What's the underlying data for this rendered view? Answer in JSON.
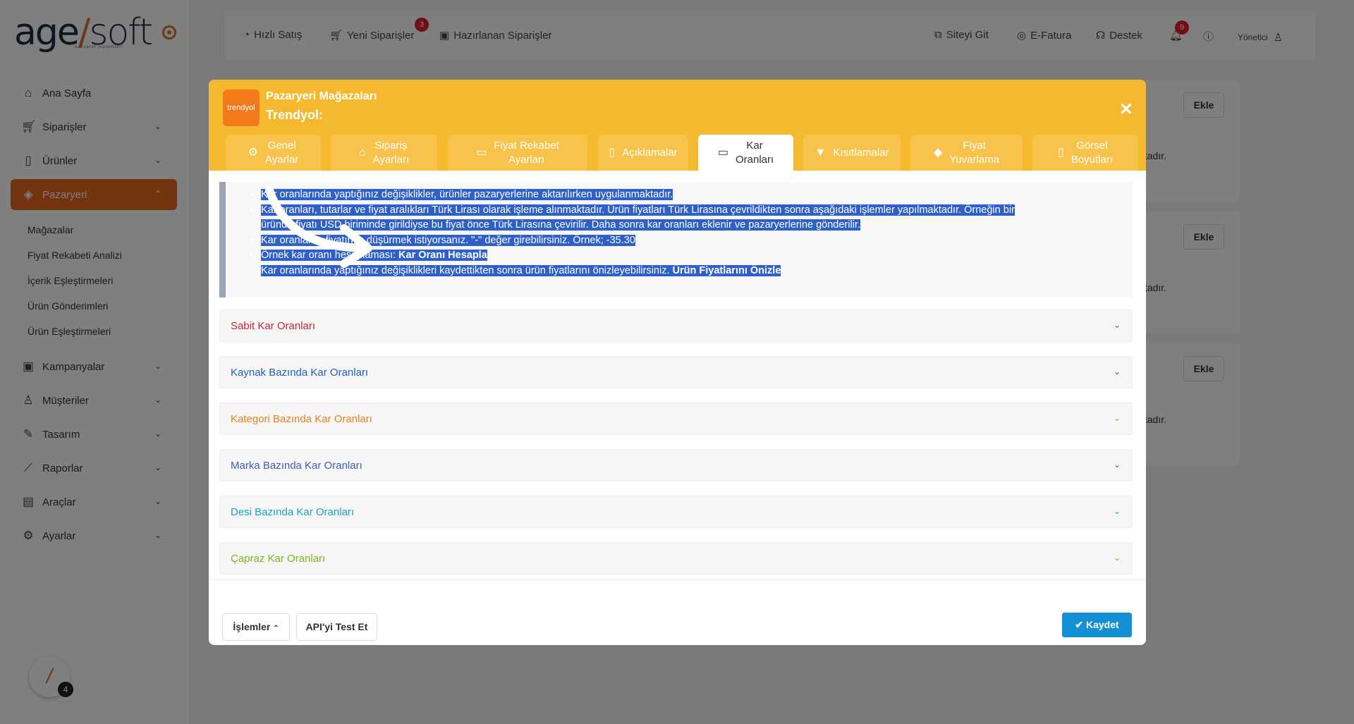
{
  "logo": {
    "brand_left": "age",
    "brand_sep": "/",
    "brand_right": "soft",
    "tagline": "e-ticaret sistemleri"
  },
  "sidebar": {
    "items": [
      {
        "label": "Ana Sayfa",
        "icon": "home-icon"
      },
      {
        "label": "Siparişler",
        "icon": "cart-icon"
      },
      {
        "label": "Ürünler",
        "icon": "book-icon"
      },
      {
        "label": "Pazaryeri",
        "icon": "box-icon"
      },
      {
        "label": "Kampanyalar",
        "icon": "gift-icon"
      },
      {
        "label": "Müşteriler",
        "icon": "user-icon"
      },
      {
        "label": "Tasarım",
        "icon": "edit-icon"
      },
      {
        "label": "Raporlar",
        "icon": "chart-icon"
      },
      {
        "label": "Araçlar",
        "icon": "clipboard-icon"
      },
      {
        "label": "Ayarlar",
        "icon": "gear-icon"
      }
    ],
    "subitems": [
      "Mağazalar",
      "Fiyat Rekabeti Analizi",
      "İçerik Eşleştirmeleri",
      "Ürün Gönderimleri",
      "Ürün Eşleştirmeleri"
    ]
  },
  "help": {
    "count": "4"
  },
  "topbar": {
    "hizli_satis": "Hızlı Satış",
    "yeni_siparisler": "Yeni Siparişler",
    "yeni_siparisler_badge": "3",
    "hazirlanan": "Hazırlanan Siparişler",
    "siteyi_git": "Siteyi Git",
    "efatura": "E-Fatura",
    "destek": "Destek",
    "notif_badge": "9",
    "user": "Yönetici"
  },
  "bg_cards": {
    "ekle": "Ekle",
    "tail": "tadır."
  },
  "modal": {
    "logo_text": "trendyol",
    "title": "Pazaryeri Mağazaları",
    "subtitle": "Trendyol:",
    "tabs": [
      {
        "l1": "Genel",
        "l2": "Ayarlar",
        "icon": "gear-icon"
      },
      {
        "l1": "Sipariş",
        "l2": "Ayarları",
        "icon": "basket-icon"
      },
      {
        "l1": "Fiyat Rekabet",
        "l2": "Ayarları",
        "icon": "money-icon"
      },
      {
        "l1": "Açıklamalar",
        "l2": "",
        "icon": "document-icon"
      },
      {
        "l1": "Kar",
        "l2": "Oranları",
        "icon": "cash-icon"
      },
      {
        "l1": "Kısıtlamalar",
        "l2": "",
        "icon": "filter-icon"
      },
      {
        "l1": "Fiyat",
        "l2": "Yuvarlama",
        "icon": "tags-icon"
      },
      {
        "l1": "Görsel",
        "l2": "Boyutları",
        "icon": "image-file-icon"
      }
    ],
    "info": {
      "line1": "Kar oranlarında yaptığınız değişiklikler, ürünler pazaryerlerine aktarılırken uygulanmaktadır.",
      "line2a": "Kar oranları, tutarlar ve fiyat aralıkları Türk Lirası olarak işleme alınmaktadır. Ürün fiyatları Türk Lirasına çevrildikten sonra aşağıdaki işlemler yapılmaktadır. Örneğin bir",
      "line2b": "ürünün fiyatı USD biriminde girildiyse bu fiyat önce Türk Lirasına çevirilir. Daha sonra kar oranları eklenir ve pazaryerlerine gönderilir.",
      "line3": "Kar oranlarını fiyatınızı düşürmek istiyorsanız. \"-\" değer girebilirsiniz. Örnek; -35.30",
      "line4": "Örnek kar oranı hesaplaması: ",
      "line4_bold": "Kar Oranı Hesapla",
      "line5": "Kar oranlarında yaptığınız değişiklikleri kaydettikten sonra ürün fiyatlarını önizleyebilirsiniz. ",
      "line5_bold": "Ürün Fiyatlarını Önizle"
    },
    "accordions": [
      {
        "label": "Sabit Kar Oranları",
        "color": "#c0283c"
      },
      {
        "label": "Kaynak Bazında Kar Oranları",
        "color": "#1f5fbf"
      },
      {
        "label": "Kategori Bazında Kar Oranları",
        "color": "#e8801a"
      },
      {
        "label": "Marka Bazında Kar Oranları",
        "color": "#3d5db8"
      },
      {
        "label": "Desi Bazında Kar Oranları",
        "color": "#1aa3c0"
      },
      {
        "label": "Çapraz Kar Oranları",
        "color": "#7fb21a"
      }
    ],
    "footer": {
      "islemler": "İşlemler",
      "api_test": "API'yi Test Et",
      "kaydet": "Kaydet"
    }
  },
  "colors": {
    "accent": "#e8671e",
    "header": "#f5b930",
    "save": "#1590d6",
    "selection": "#2f60c7"
  }
}
